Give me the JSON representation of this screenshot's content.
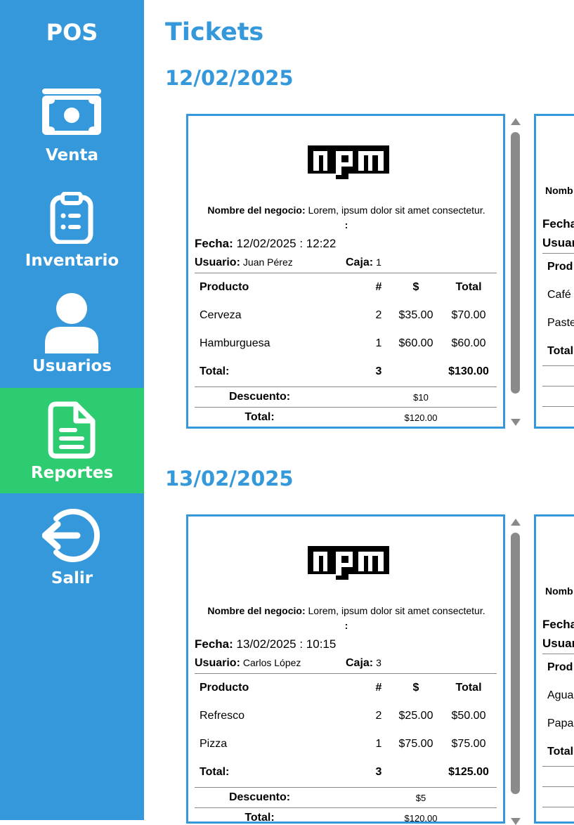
{
  "sidebar": {
    "brand": "POS",
    "items": [
      {
        "label": "Venta",
        "icon": "money-bill-icon"
      },
      {
        "label": "Inventario",
        "icon": "clipboard-list-icon"
      },
      {
        "label": "Usuarios",
        "icon": "user-icon"
      },
      {
        "label": "Reportes",
        "icon": "file-text-icon",
        "active": true
      },
      {
        "label": "Salir",
        "icon": "logout-icon"
      }
    ]
  },
  "colors": {
    "sidebar": "#3498db",
    "active": "#2ecc71",
    "accent": "#3498db"
  },
  "main": {
    "title": "Tickets",
    "groups": [
      {
        "date": "12/02/2025",
        "ticket": {
          "logo": "npm-logo",
          "business_label": "Nombre del negocio:",
          "business_value": "Lorem, ipsum dolor sit amet consectetur.",
          "colon": ":",
          "fecha_label": "Fecha:",
          "fecha_value": "12/02/2025 : 12:22",
          "usuario_label": "Usuario:",
          "usuario_value": "Juan Pérez",
          "caja_label": "Caja:",
          "caja_value": "1",
          "headers": {
            "product": "Producto",
            "qty": "#",
            "price": "$",
            "total": "Total"
          },
          "items": [
            {
              "product": "Cerveza",
              "qty": "2",
              "price": "$35.00",
              "total": "$70.00"
            },
            {
              "product": "Hamburguesa",
              "qty": "1",
              "price": "$60.00",
              "total": "$60.00"
            }
          ],
          "totals": {
            "label": "Total:",
            "qty": "3",
            "total": "$130.00"
          },
          "discount_label": "Descuento:",
          "discount_value": "$10",
          "final_label": "Total:",
          "final_value": "$120.00"
        },
        "peek": {
          "biz": "Nomb",
          "fecha": "Fecha",
          "usuario": "Usuar",
          "product": "Prod",
          "item1": "Café",
          "item2": "Paste",
          "total": "Total"
        }
      },
      {
        "date": "13/02/2025",
        "ticket": {
          "logo": "npm-logo",
          "business_label": "Nombre del negocio:",
          "business_value": "Lorem, ipsum dolor sit amet consectetur.",
          "colon": ":",
          "fecha_label": "Fecha:",
          "fecha_value": "13/02/2025 : 10:15",
          "usuario_label": "Usuario:",
          "usuario_value": "Carlos López",
          "caja_label": "Caja:",
          "caja_value": "3",
          "headers": {
            "product": "Producto",
            "qty": "#",
            "price": "$",
            "total": "Total"
          },
          "items": [
            {
              "product": "Refresco",
              "qty": "2",
              "price": "$25.00",
              "total": "$50.00"
            },
            {
              "product": "Pizza",
              "qty": "1",
              "price": "$75.00",
              "total": "$75.00"
            }
          ],
          "totals": {
            "label": "Total:",
            "qty": "3",
            "total": "$125.00"
          },
          "discount_label": "Descuento:",
          "discount_value": "$5",
          "final_label": "Total:",
          "final_value": "$120.00"
        },
        "peek": {
          "biz": "Nomb",
          "fecha": "Fecha",
          "usuario": "Usuar",
          "product": "Prod",
          "item1": "Agua",
          "item2": "Papas",
          "total": "Total"
        }
      }
    ]
  }
}
